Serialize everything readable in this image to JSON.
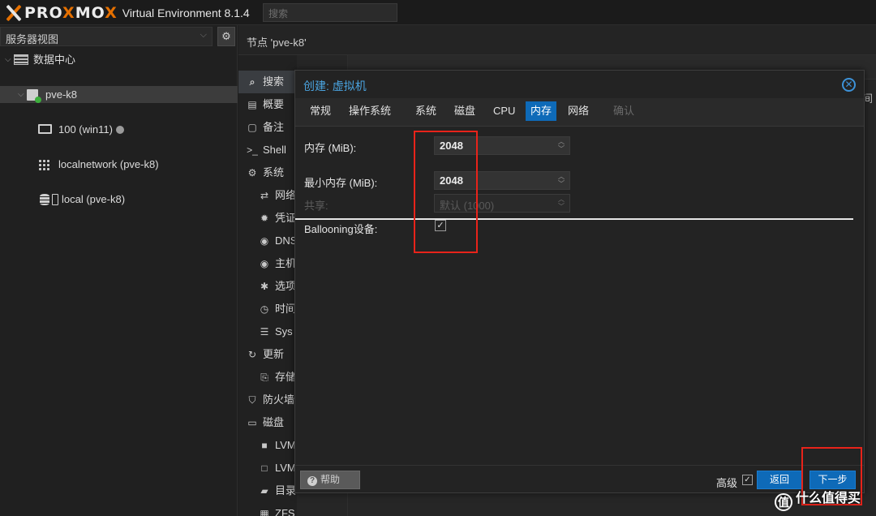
{
  "topbar": {
    "logo_accent": "X",
    "logo_pre": "PRO",
    "logo_mid": "X",
    "logo_post": "MO",
    "logo_end": "X",
    "version": "Virtual Environment 8.1.4",
    "search_placeholder": "搜索"
  },
  "left": {
    "view_selector": "服务器视图",
    "tree": {
      "datacenter": "数据中心",
      "node": "pve-k8",
      "vm": "100 (win11)",
      "network": "localnetwork (pve-k8)",
      "storage": "local (pve-k8)"
    }
  },
  "breadcrumb": "节点 'pve-k8'",
  "menu": [
    {
      "label": "搜索",
      "icon": "search-icon"
    },
    {
      "label": "概要",
      "icon": "summary-icon"
    },
    {
      "label": "备注",
      "icon": "notes-icon"
    },
    {
      "label": "Shell",
      "icon": "terminal-icon"
    },
    {
      "label": "系统",
      "icon": "gears-icon"
    },
    {
      "label": "网络",
      "icon": "network-icon"
    },
    {
      "label": "凭证",
      "icon": "certificate-icon"
    },
    {
      "label": "DNS",
      "icon": "globe-icon"
    },
    {
      "label": "主机",
      "icon": "globe-icon"
    },
    {
      "label": "选项",
      "icon": "gear-icon"
    },
    {
      "label": "时间",
      "icon": "clock-icon"
    },
    {
      "label": "Sys",
      "icon": "list-icon"
    },
    {
      "label": "更新",
      "icon": "refresh-icon"
    },
    {
      "label": "存储",
      "icon": "repository-icon"
    },
    {
      "label": "防火墙",
      "icon": "shield-icon"
    },
    {
      "label": "磁盘",
      "icon": "disk-icon"
    },
    {
      "label": "LVM",
      "icon": "square-icon"
    },
    {
      "label": "LVM",
      "icon": "square-outline-icon"
    },
    {
      "label": "目录",
      "icon": "folder-icon"
    },
    {
      "label": "ZFS",
      "icon": "grid-icon"
    }
  ],
  "behind": {
    "tail_text": "间"
  },
  "modal": {
    "title": "创建: 虚拟机",
    "tabs": [
      "常规",
      "操作系统",
      "系统",
      "磁盘",
      "CPU",
      "内存",
      "网络",
      "确认"
    ],
    "active_tab": "内存",
    "memory_label": "内存 (MiB):",
    "memory_value": "2048",
    "min_memory_label": "最小内存 (MiB):",
    "min_memory_value": "2048",
    "shares_label": "共享:",
    "shares_value": "默认 (1000)",
    "ballooning_label": "Ballooning设备:",
    "ballooning_checked": true,
    "help_label": "帮助",
    "advanced_label": "高级",
    "back_label": "返回",
    "next_label": "下一步"
  },
  "watermark": {
    "glyph": "值",
    "text": "什么值得买"
  },
  "colors": {
    "accent": "#0e6ab8",
    "title": "#4aa3df",
    "annotation": "#e8231a",
    "logo": "#e57000"
  }
}
